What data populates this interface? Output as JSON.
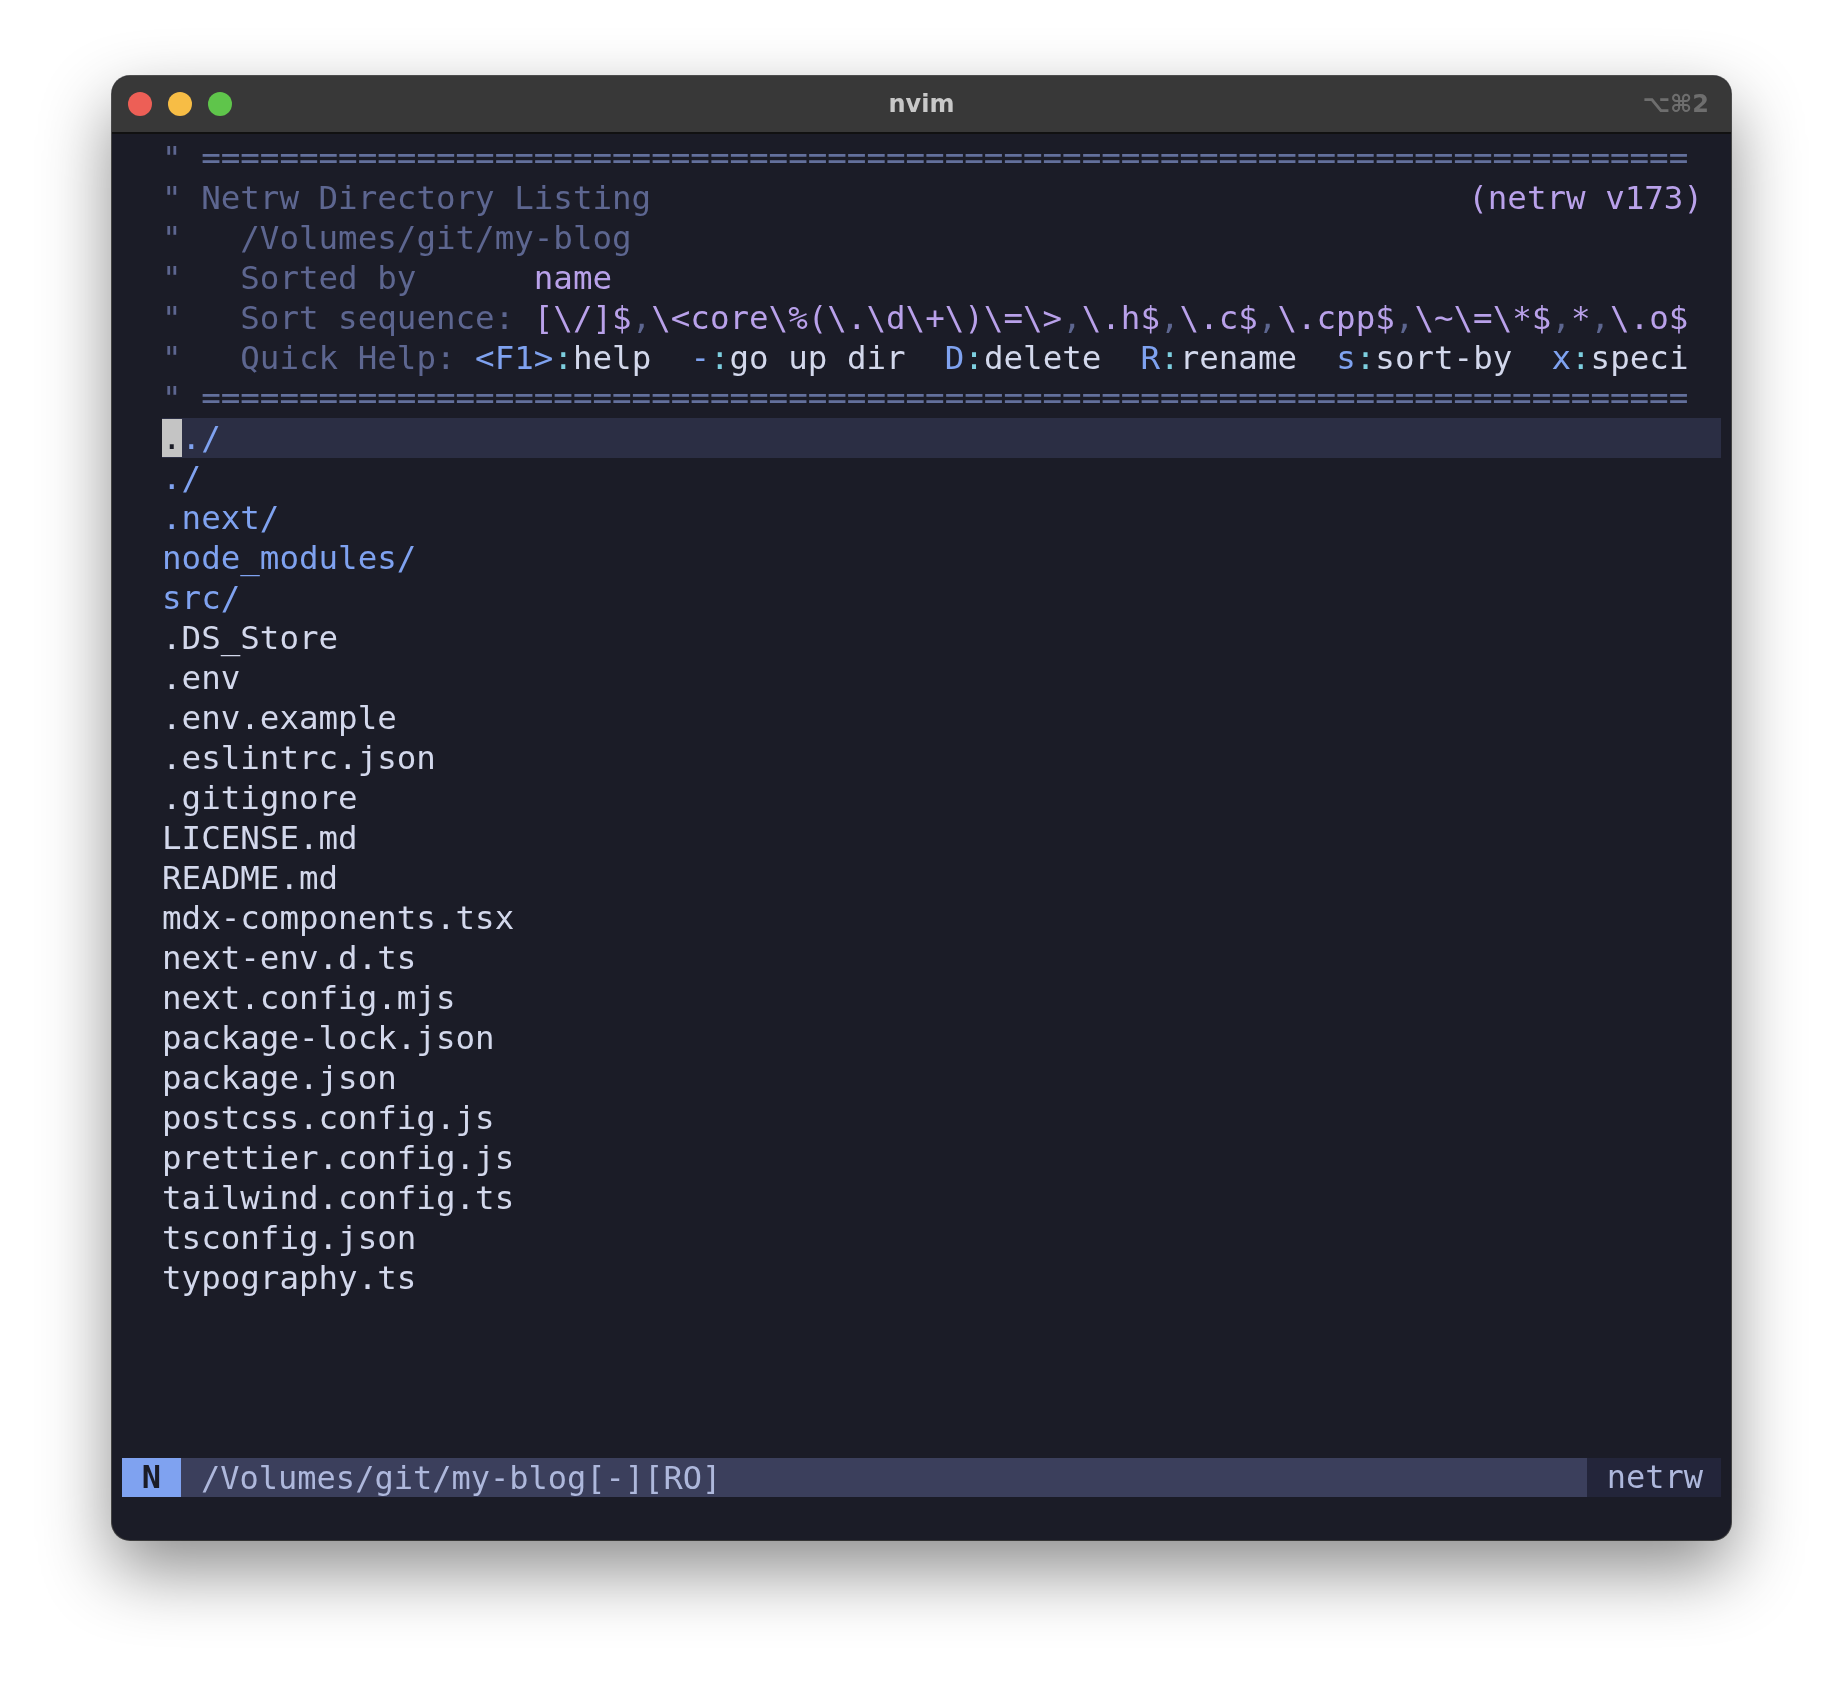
{
  "window": {
    "title": "nvim",
    "shortcut": "⌥⌘2"
  },
  "header": {
    "mark": "\"",
    "rule_top": "============================================================================",
    "title": "Netrw Directory Listing",
    "version": "(netrw v173)",
    "path": "/Volumes/git/my-blog",
    "sorted_label": "Sorted by",
    "sorted_value": "name",
    "sequence_label": "Sort sequence:",
    "sequence_separator": ",",
    "sequence": [
      "[\\/]$",
      "\\<core\\%(\\.\\d\\+\\)\\=\\>",
      "\\.h$",
      "\\.c$",
      "\\.cpp$",
      "\\~\\=\\*$",
      "*",
      "\\.o$"
    ],
    "help_label": "Quick Help:",
    "help": [
      {
        "key": "<F1>",
        "sep": ":",
        "action": "help"
      },
      {
        "key": "-",
        "sep": ":",
        "action": "go up dir"
      },
      {
        "key": "D",
        "sep": ":",
        "action": "delete"
      },
      {
        "key": "R",
        "sep": ":",
        "action": "rename"
      },
      {
        "key": "s",
        "sep": ":",
        "action": "sort-by"
      },
      {
        "key": "x",
        "sep": ":",
        "action": "speci"
      }
    ],
    "rule_bottom": "============================================================================"
  },
  "entries": [
    {
      "name": "../",
      "kind": "dir",
      "selected": true
    },
    {
      "name": "./",
      "kind": "dir",
      "selected": false
    },
    {
      "name": ".next/",
      "kind": "dir",
      "selected": false
    },
    {
      "name": "node_modules/",
      "kind": "dir",
      "selected": false
    },
    {
      "name": "src/",
      "kind": "dir",
      "selected": false
    },
    {
      "name": ".DS_Store",
      "kind": "file",
      "selected": false
    },
    {
      "name": ".env",
      "kind": "file",
      "selected": false
    },
    {
      "name": ".env.example",
      "kind": "file",
      "selected": false
    },
    {
      "name": ".eslintrc.json",
      "kind": "file",
      "selected": false
    },
    {
      "name": ".gitignore",
      "kind": "file",
      "selected": false
    },
    {
      "name": "LICENSE.md",
      "kind": "file",
      "selected": false
    },
    {
      "name": "README.md",
      "kind": "file",
      "selected": false
    },
    {
      "name": "mdx-components.tsx",
      "kind": "file",
      "selected": false
    },
    {
      "name": "next-env.d.ts",
      "kind": "file",
      "selected": false
    },
    {
      "name": "next.config.mjs",
      "kind": "file",
      "selected": false
    },
    {
      "name": "package-lock.json",
      "kind": "file",
      "selected": false
    },
    {
      "name": "package.json",
      "kind": "file",
      "selected": false
    },
    {
      "name": "postcss.config.js",
      "kind": "file",
      "selected": false
    },
    {
      "name": "prettier.config.js",
      "kind": "file",
      "selected": false
    },
    {
      "name": "tailwind.config.ts",
      "kind": "file",
      "selected": false
    },
    {
      "name": "tsconfig.json",
      "kind": "file",
      "selected": false
    },
    {
      "name": "typography.ts",
      "kind": "file",
      "selected": false
    }
  ],
  "status_bar": {
    "mode": "N",
    "path": "/Volumes/git/my-blog[-][RO]",
    "filetype": "netrw"
  }
}
